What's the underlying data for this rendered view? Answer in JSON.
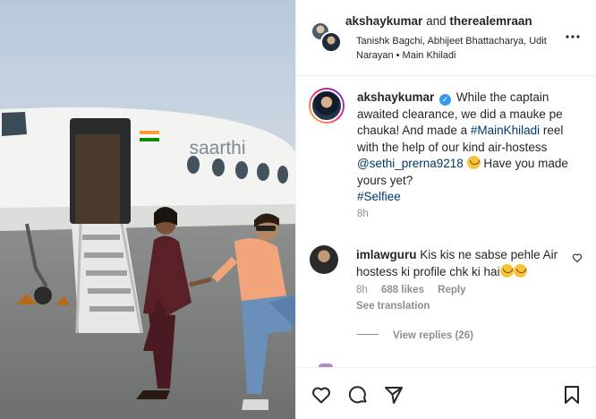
{
  "header": {
    "author_primary": "akshaykumar",
    "author_joiner": "and",
    "author_secondary": "therealemraan",
    "audio_credit": "Tanishk Bagchi, Abhijeet Bhattacharya, Udit Narayan • Main Khiladi"
  },
  "media": {
    "plane_name": "saarthi"
  },
  "caption": {
    "username": "akshaykumar",
    "text_1": "While the captain awaited clearance, we did a mauke pe chauka! And made a ",
    "hashtag_1": "#MainKhiladi",
    "text_2": " reel with the help of our kind air-hostess ",
    "mention": "@sethi_prerna9218",
    "text_3": " Have you made yours yet?",
    "hashtag_2": "#Selfiee",
    "time": "8h"
  },
  "comment": {
    "username": "imlawguru",
    "text": "Kis kis ne sabse pehle Air hostess ki profile chk ki hai",
    "time": "8h",
    "likes": "688 likes",
    "reply_label": "Reply",
    "see_translation": "See translation",
    "view_replies": "View replies (26)"
  },
  "colors": {
    "link": "#00376b",
    "secondary_text": "#8e8e8e",
    "verified": "#3897f0"
  },
  "icons": [
    "more-icon",
    "verified-icon",
    "heart-icon",
    "comment-icon",
    "share-icon",
    "bookmark-icon"
  ]
}
